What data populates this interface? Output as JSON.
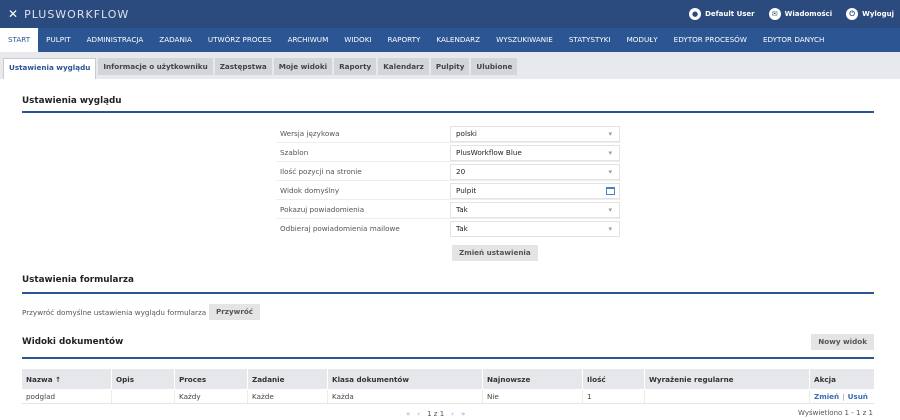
{
  "app": {
    "logo_text": "PLUSWORKFLOW",
    "user_label": "Default User",
    "messages_label": "Wiadomości",
    "logout_label": "Wyloguj"
  },
  "menu": {
    "items": [
      "START",
      "PULPIT",
      "ADMINISTRACJA",
      "ZADANIA",
      "UTWÓRZ PROCES",
      "ARCHIWUM",
      "WIDOKI",
      "RAPORTY",
      "KALENDARZ",
      "WYSZUKIWANIE",
      "STATYSTYKI",
      "MODUŁY",
      "EDYTOR PROCESÓW",
      "EDYTOR DANYCH"
    ],
    "active": "START"
  },
  "tabs": {
    "items": [
      "Ustawienia wyglądu",
      "Informacje o użytkowniku",
      "Zastępstwa",
      "Moje widoki",
      "Raporty",
      "Kalendarz",
      "Pulpity",
      "Ulubione"
    ],
    "active": "Ustawienia wyglądu"
  },
  "appearance": {
    "title": "Ustawienia wyglądu",
    "fields": [
      {
        "label": "Wersja językowa",
        "value": "polski",
        "control": "select"
      },
      {
        "label": "Szablon",
        "value": "PlusWorkflow Blue",
        "control": "select"
      },
      {
        "label": "Ilość pozycji na stronie",
        "value": "20",
        "control": "select"
      },
      {
        "label": "Widok domyślny",
        "value": "Pulpit",
        "control": "date"
      },
      {
        "label": "Pokazuj powiadomienia",
        "value": "Tak",
        "control": "select"
      },
      {
        "label": "Odbieraj powiadomienia mailowe",
        "value": "Tak",
        "control": "select"
      }
    ],
    "submit_label": "Zmień ustawienia"
  },
  "form_settings": {
    "title": "Ustawienia formularza",
    "restore_text": "Przywróć domyślne ustawienia wyglądu formularza",
    "restore_button": "Przywróć"
  },
  "doc_views": {
    "title": "Widoki dokumentów",
    "new_button": "Nowy widok",
    "columns": [
      "Nazwa ↑",
      "Opis",
      "Proces",
      "Zadanie",
      "Klasa dokumentów",
      "Najnowsze",
      "Ilość",
      "Wyrażenie regularne",
      "Akcja"
    ],
    "rows": [
      {
        "nazwa": "podglad",
        "opis": "",
        "proces": "Każdy",
        "zadanie": "Każde",
        "klasa": "Każda",
        "najnowsze": "Nie",
        "ilosc": "1",
        "wyrazenie": "",
        "akcja_edit": "Zmień",
        "akcja_sep": "|",
        "akcja_delete": "Usuń"
      }
    ],
    "pager": {
      "first": "«",
      "prev": "‹",
      "pages": "1 z 1",
      "next": "›",
      "last": "»"
    },
    "info": "Wyświetlono 1 - 1 z 1"
  }
}
